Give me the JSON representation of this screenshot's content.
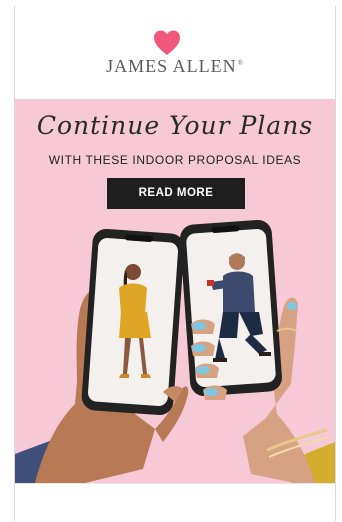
{
  "brand": {
    "name": "JAMES ALLEN",
    "registered_mark": "®",
    "heart_color": "#f0577a"
  },
  "hero": {
    "background_color": "#f7c8d6",
    "script_title": "Continue Your Plans",
    "subtitle": "WITH THESE INDOOR PROPOSAL IDEAS",
    "cta_label": "READ MORE"
  }
}
